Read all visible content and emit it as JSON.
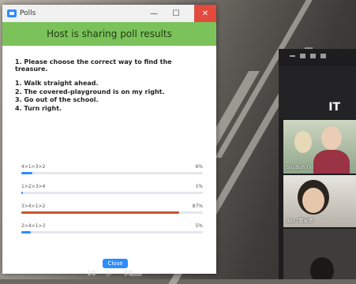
{
  "window": {
    "app_title": "Polls",
    "minimize": "—",
    "maximize": "☐",
    "close": "✕"
  },
  "banner": "Host is sharing poll results",
  "question": "1. Please choose the correct way to find the treasure.",
  "options": [
    "1. Walk straight ahead.",
    "2. The covered-playground is on my right.",
    "3. Go out of the school.",
    "4. Turn right."
  ],
  "results": [
    {
      "label": "4>1>3>2",
      "percent_text": "6%",
      "percent": 6,
      "color": "#2d8cff"
    },
    {
      "label": "1>2>3>4",
      "percent_text": "1%",
      "percent": 1,
      "color": "#2d8cff"
    },
    {
      "label": "3>4>1>2",
      "percent_text": "87%",
      "percent": 87,
      "color": "#c6552e"
    },
    {
      "label": "2>4>1>3",
      "percent_text": "5%",
      "percent": 5,
      "color": "#2d8cff"
    }
  ],
  "close_label": "Close",
  "panel": {
    "host_label": "IT",
    "participants": [
      "Siu Bun Tin",
      "4B17黎安晴"
    ]
  },
  "controls": [
    "10",
    "▷",
    "30"
  ]
}
